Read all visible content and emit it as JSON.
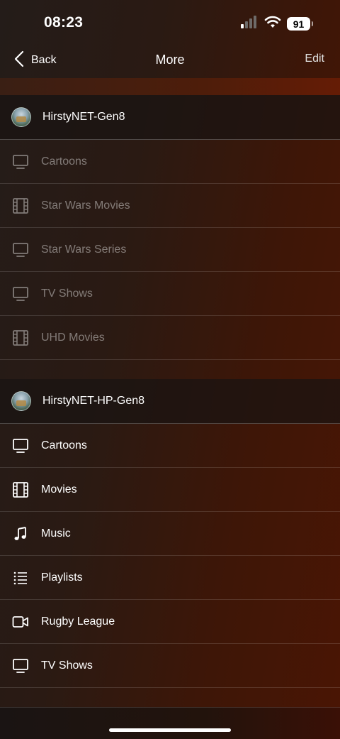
{
  "status_bar": {
    "time": "08:23",
    "battery": "91"
  },
  "nav": {
    "back_label": "Back",
    "title": "More",
    "edit_label": "Edit"
  },
  "sections": [
    {
      "server": "HirstyNET-Gen8",
      "items": [
        {
          "label": "Cartoons",
          "icon": "tv-icon"
        },
        {
          "label": "Star Wars Movies",
          "icon": "film-icon"
        },
        {
          "label": "Star Wars Series",
          "icon": "tv-icon"
        },
        {
          "label": "TV Shows",
          "icon": "tv-icon"
        },
        {
          "label": "UHD Movies",
          "icon": "film-icon"
        }
      ]
    },
    {
      "server": "HirstyNET-HP-Gen8",
      "items": [
        {
          "label": "Cartoons",
          "icon": "tv-icon"
        },
        {
          "label": "Movies",
          "icon": "film-icon"
        },
        {
          "label": "Music",
          "icon": "music-note-icon"
        },
        {
          "label": "Playlists",
          "icon": "list-icon"
        },
        {
          "label": "Rugby League",
          "icon": "video-camera-icon"
        },
        {
          "label": "TV Shows",
          "icon": "tv-icon"
        }
      ]
    }
  ]
}
